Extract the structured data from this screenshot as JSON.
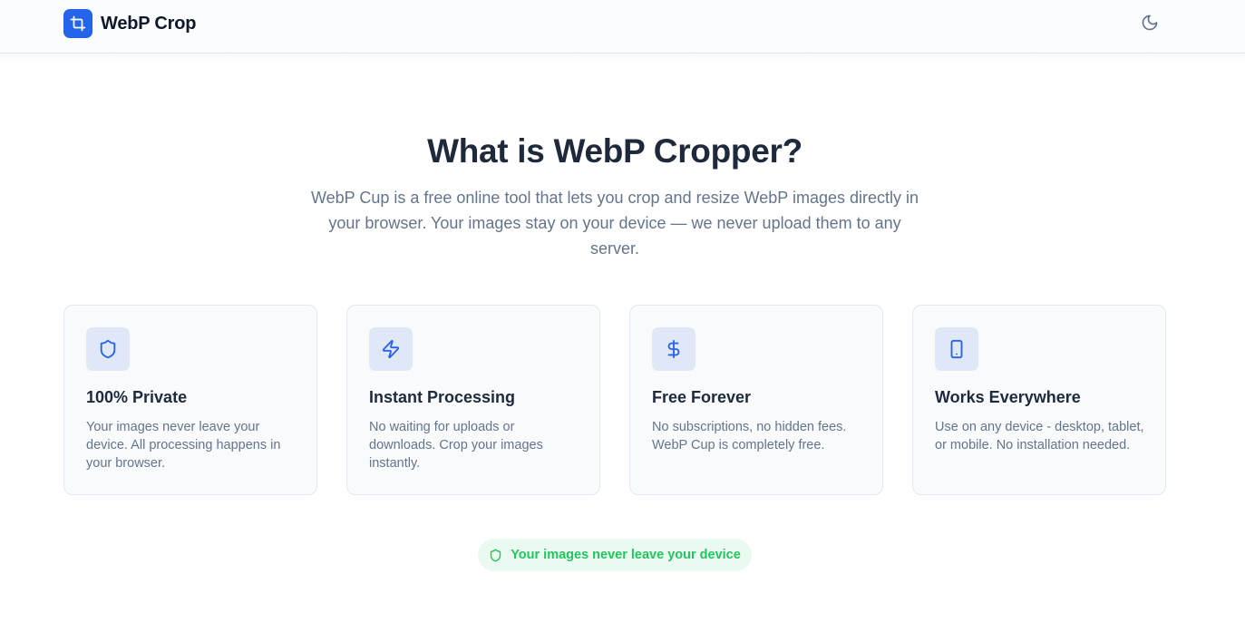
{
  "header": {
    "app_name": "WebP Crop",
    "logo_icon": "crop-icon",
    "theme_toggle_icon": "moon-icon"
  },
  "hero": {
    "title": "What is WebP Cropper?",
    "description": "WebP Cup is a free online tool that lets you crop and resize WebP images directly in your browser. Your images stay on your device — we never upload them to any server."
  },
  "features": [
    {
      "icon": "shield-icon",
      "title": "100% Private",
      "text": "Your images never leave your device. All processing happens in your browser."
    },
    {
      "icon": "zap-icon",
      "title": "Instant Processing",
      "text": "No waiting for uploads or downloads. Crop your images instantly."
    },
    {
      "icon": "dollar-icon",
      "title": "Free Forever",
      "text": "No subscriptions, no hidden fees. WebP Cup is completely free."
    },
    {
      "icon": "tablet-icon",
      "title": "Works Everywhere",
      "text": "Use on any device - desktop, tablet, or mobile. No installation needed."
    }
  ],
  "privacy_badge": {
    "icon": "shield-icon",
    "text": "Your images never leave your device"
  },
  "colors": {
    "brand": "#2563eb",
    "icon_bg": "#e0e8f7",
    "badge_green": "#22c55e",
    "badge_bg": "#ebfaf0",
    "heading": "#1e293b",
    "muted": "#64748b"
  }
}
